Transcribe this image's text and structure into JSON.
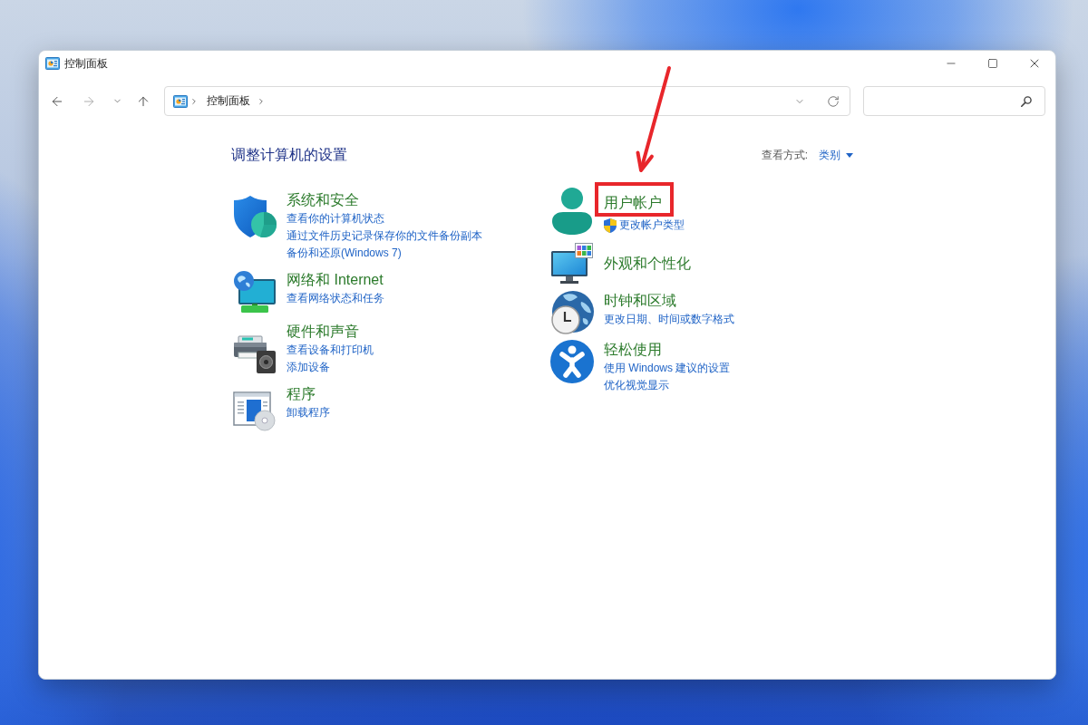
{
  "window": {
    "title": "控制面板"
  },
  "navigation": [
    {
      "kind": "back",
      "disabled": false
    },
    {
      "kind": "forward",
      "disabled": true
    },
    {
      "kind": "recent",
      "disabled": false
    },
    {
      "kind": "up",
      "disabled": false
    }
  ],
  "address_bar": {
    "path": [
      "控制面板"
    ]
  },
  "heading": "调整计算机的设置",
  "view_by": {
    "label": "查看方式:",
    "value": "类别"
  },
  "columns": [
    {
      "categories": [
        {
          "kind": "security",
          "title": "系统和安全",
          "highlighted": false,
          "links": [
            {
              "text": "查看你的计算机状态",
              "shield": false
            },
            {
              "text": "通过文件历史记录保存你的文件备份副本",
              "shield": false
            },
            {
              "text": "备份和还原(Windows 7)",
              "shield": false
            }
          ]
        },
        {
          "kind": "network",
          "title": "网络和 Internet",
          "highlighted": false,
          "links": [
            {
              "text": "查看网络状态和任务",
              "shield": false
            }
          ]
        },
        {
          "kind": "hardware",
          "title": "硬件和声音",
          "highlighted": false,
          "links": [
            {
              "text": "查看设备和打印机",
              "shield": false
            },
            {
              "text": "添加设备",
              "shield": false
            }
          ]
        },
        {
          "kind": "programs",
          "title": "程序",
          "highlighted": false,
          "links": [
            {
              "text": "卸载程序",
              "shield": false
            }
          ]
        }
      ]
    },
    {
      "categories": [
        {
          "kind": "user",
          "title": "用户帐户",
          "highlighted": true,
          "links": [
            {
              "text": "更改帐户类型",
              "shield": true
            }
          ]
        },
        {
          "kind": "appearance",
          "title": "外观和个性化",
          "highlighted": false
        },
        {
          "kind": "clock",
          "title": "时钟和区域",
          "highlighted": false,
          "links": [
            {
              "text": "更改日期、时间或数字格式",
              "shield": false
            }
          ]
        },
        {
          "kind": "accessibility",
          "title": "轻松使用",
          "highlighted": false,
          "links": [
            {
              "text": "使用 Windows 建议的设置",
              "shield": false
            },
            {
              "text": "优化视觉显示",
              "shield": false
            }
          ]
        }
      ]
    }
  ]
}
